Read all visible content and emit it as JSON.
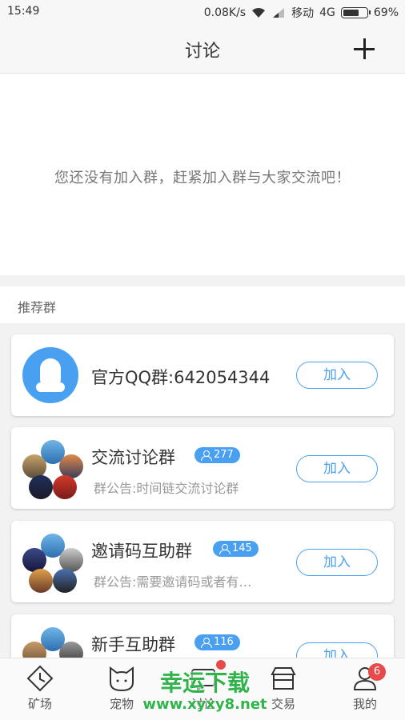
{
  "status_bar": {
    "time": "15:49",
    "speed": "0.08K/s",
    "carrier": "移动",
    "network": "4G",
    "battery": "69%",
    "battery_level": 0.69
  },
  "header": {
    "title": "讨论",
    "add_icon": "plus-icon"
  },
  "empty_state": {
    "message": "您还没有加入群，赶紧加入群与大家交流吧！"
  },
  "recommended": {
    "section_label": "推荐群",
    "join_label": "加入",
    "groups": [
      {
        "name": "官方QQ群:642054344"
      },
      {
        "name": "交流讨论群",
        "members": "277",
        "notice": "群公告:时间链交流讨论群"
      },
      {
        "name": "邀请码互助群",
        "members": "145",
        "notice": "群公告:需要邀请码或者有…"
      },
      {
        "name": "新手互助群",
        "members": "116"
      }
    ]
  },
  "tabbar": {
    "tabs": [
      {
        "label": "矿场",
        "icon": "clock-icon"
      },
      {
        "label": "宠物",
        "icon": "cat-icon"
      },
      {
        "label": "讨论",
        "icon": "chat-icon"
      },
      {
        "label": "交易",
        "icon": "store-icon"
      },
      {
        "label": "我的",
        "icon": "user-icon",
        "badge": "6"
      }
    ]
  },
  "watermark": {
    "line1": "幸运下载",
    "line2": "www.xyxy8.net"
  },
  "colors": {
    "accent": "#4aa0f0",
    "badge_red": "#e54b4b",
    "watermark_green": "#2fb34a"
  }
}
